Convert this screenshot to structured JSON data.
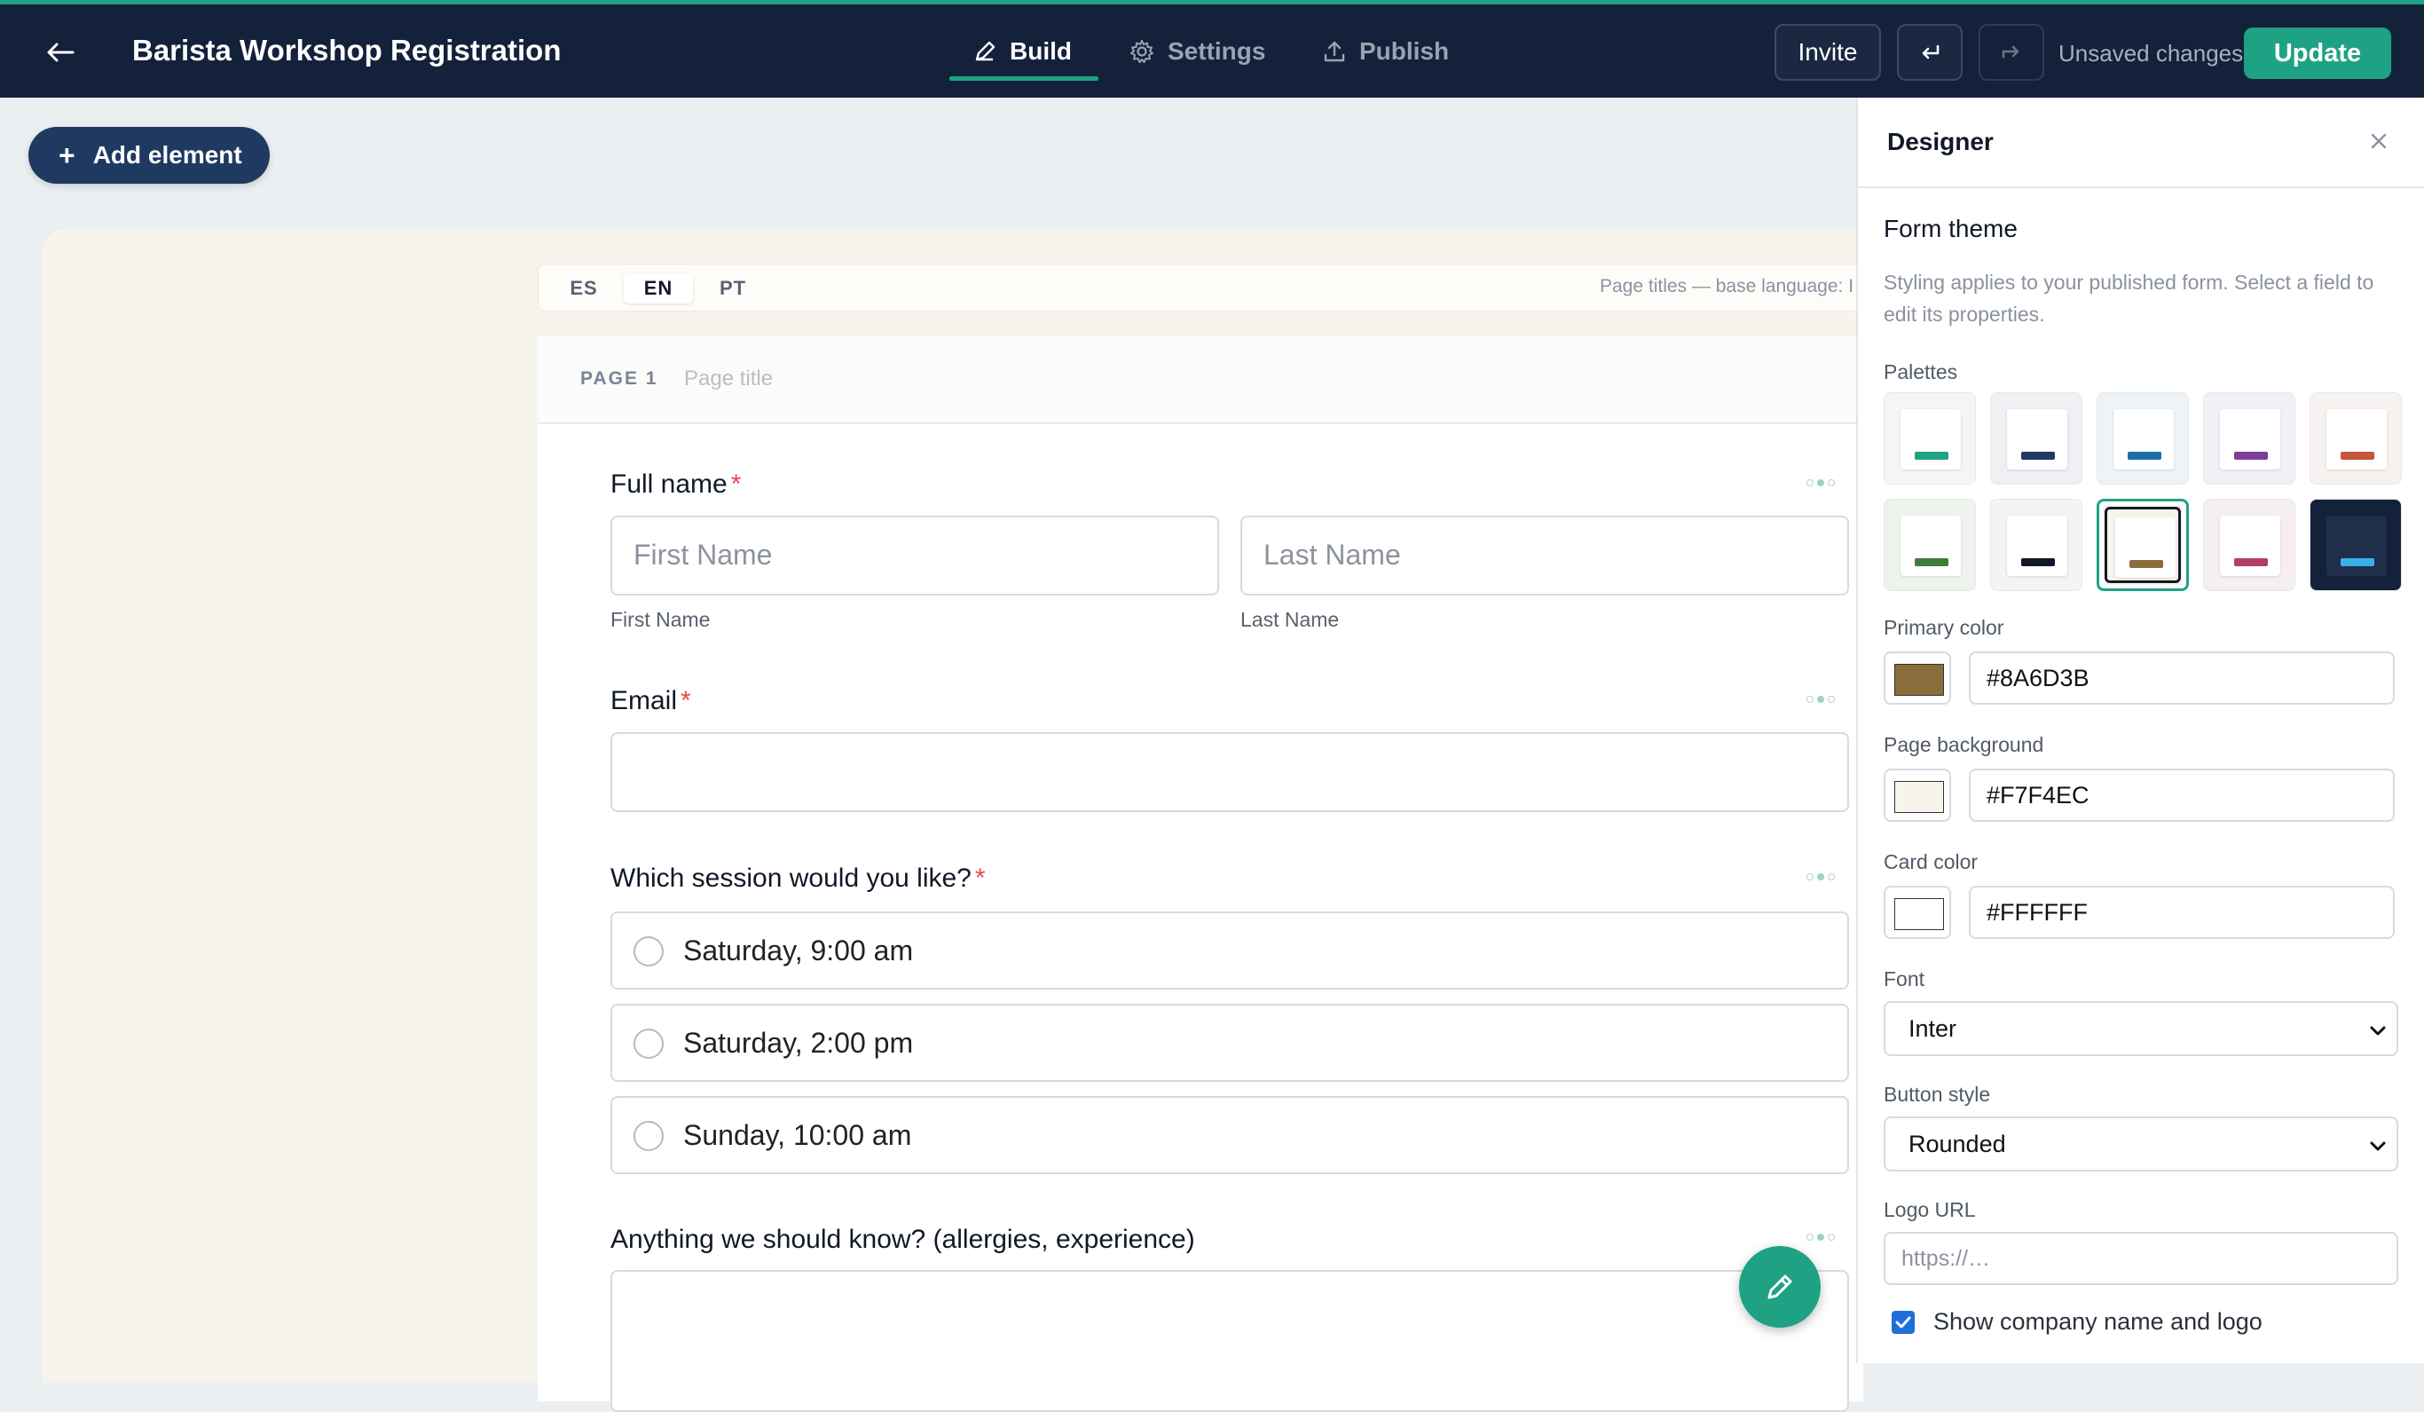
{
  "header": {
    "title": "Barista Workshop Registration",
    "tabs": [
      {
        "label": "Build",
        "icon": "pencil-icon",
        "active": true
      },
      {
        "label": "Settings",
        "icon": "gear-icon",
        "active": false
      },
      {
        "label": "Publish",
        "icon": "upload-icon",
        "active": false
      }
    ],
    "invite_label": "Invite",
    "status": "Unsaved changes",
    "update_label": "Update",
    "accent_color": "#1FA283"
  },
  "canvas": {
    "add_element_label": "Add element",
    "languages": [
      "ES",
      "EN",
      "PT"
    ],
    "active_language": "EN",
    "language_note": "Page titles — base language: I",
    "page_label": "PAGE 1",
    "page_title_placeholder": "Page title",
    "fields": {
      "full_name": {
        "label": "Full name",
        "required": "*",
        "first_placeholder": "First Name",
        "last_placeholder": "Last Name",
        "first_sublabel": "First Name",
        "last_sublabel": "Last Name"
      },
      "email": {
        "label": "Email",
        "required": "*"
      },
      "session": {
        "label": "Which session would you like?",
        "required": "*",
        "options": [
          "Saturday, 9:00 am",
          "Saturday, 2:00 pm",
          "Sunday, 10:00 am"
        ]
      },
      "notes": {
        "label": "Anything we should know? (allergies, experience)"
      }
    }
  },
  "designer": {
    "title": "Designer",
    "section_title": "Form theme",
    "help_text": "Styling applies to your published form. Select a field to edit its properties.",
    "palettes_label": "Palettes",
    "palettes": [
      {
        "bg": "#F4F5F5",
        "accent": "#1FA283"
      },
      {
        "bg": "#EEF0F4",
        "accent": "#1F3A60"
      },
      {
        "bg": "#EEF3F8",
        "accent": "#1E6FA8"
      },
      {
        "bg": "#F3EFF6",
        "accent": "#7C3E96"
      },
      {
        "bg": "#F7F2EF",
        "accent": "#C2583A"
      },
      {
        "bg": "#EFF3EE",
        "accent": "#3E7D3A"
      },
      {
        "bg": "#F3F4F6",
        "accent": "#111827"
      },
      {
        "bg": "#F7F4EC",
        "accent": "#8A6D3B",
        "selected": true
      },
      {
        "bg": "#F7EEF2",
        "accent": "#B43C6B"
      },
      {
        "bg": "#13213A",
        "accent": "#3BB0E8",
        "dark": true
      }
    ],
    "primary_color": {
      "label": "Primary color",
      "value": "#8A6D3B"
    },
    "page_background": {
      "label": "Page background",
      "value": "#F7F4EC"
    },
    "card_color": {
      "label": "Card color",
      "value": "#FFFFFF"
    },
    "font": {
      "label": "Font",
      "value": "Inter"
    },
    "button_style": {
      "label": "Button style",
      "value": "Rounded"
    },
    "logo_url": {
      "label": "Logo URL",
      "placeholder": "https://…"
    },
    "show_company": {
      "label": "Show company name and logo",
      "checked": true
    }
  }
}
